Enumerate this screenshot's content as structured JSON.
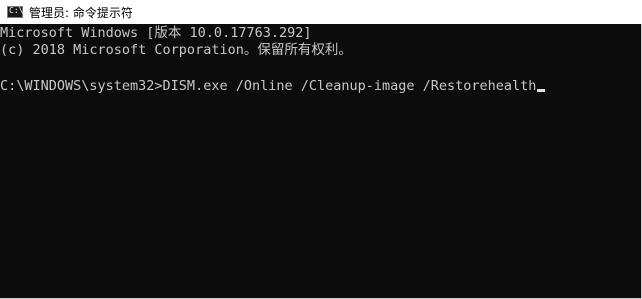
{
  "window": {
    "title": "管理员: 命令提示符",
    "icon": "cmd-icon",
    "icon_glyph": "C:\\"
  },
  "console": {
    "lines": [
      "Microsoft Windows [版本 10.0.17763.292]",
      "(c) 2018 Microsoft Corporation。保留所有权利。",
      "C:\\WINDOWS\\system32>DISM.exe /Online /Cleanup-image /Restorehealth"
    ],
    "colors": {
      "background": "#0c0c0c",
      "text": "#c8c8c8"
    }
  }
}
